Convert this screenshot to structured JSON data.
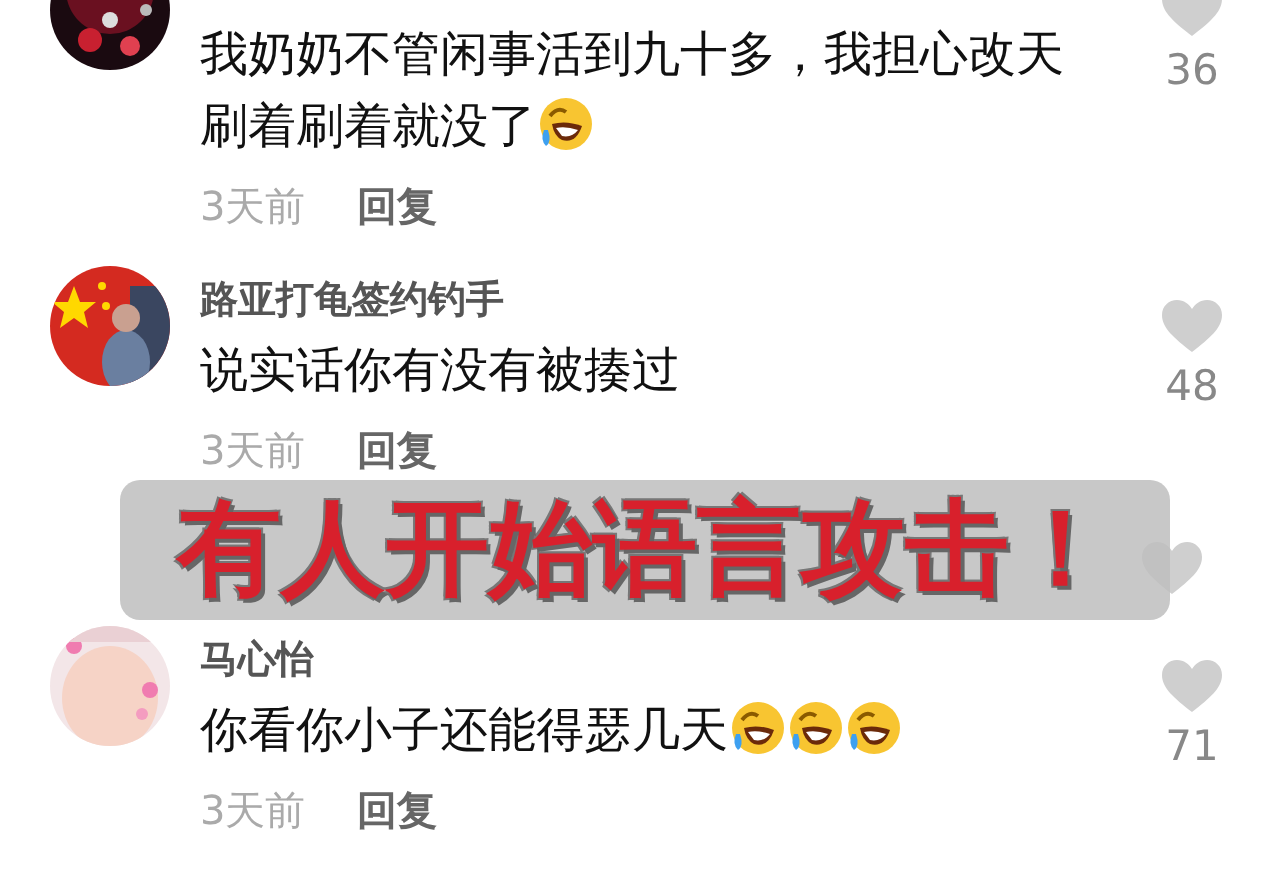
{
  "comments": [
    {
      "avatar": {
        "kind": "picture"
      },
      "lines": [
        "我奶奶不管闲事活到九十多，我担心改天",
        "刷着刷着就没了"
      ],
      "emojis": [
        {
          "kind": "laugh-cry"
        }
      ],
      "time": "3天前",
      "reply": "回复",
      "likes": "36"
    },
    {
      "avatar": {
        "kind": "picture"
      },
      "name": "路亚打龟签约钓手",
      "lines": [
        "说实话你有没有被揍过"
      ],
      "time": "3天前",
      "reply": "回复",
      "likes": "48"
    },
    {
      "avatar": {
        "kind": "picture"
      },
      "name": "马心怡",
      "lines": [
        "你看你小子还能得瑟几天"
      ],
      "emojis": [
        {
          "kind": "laugh-cry"
        },
        {
          "kind": "laugh-cry"
        },
        {
          "kind": "laugh-cry"
        }
      ],
      "time": "3天前",
      "reply": "回复",
      "likes": "71"
    }
  ],
  "overlay": {
    "text": "有人开始语言攻击！"
  }
}
